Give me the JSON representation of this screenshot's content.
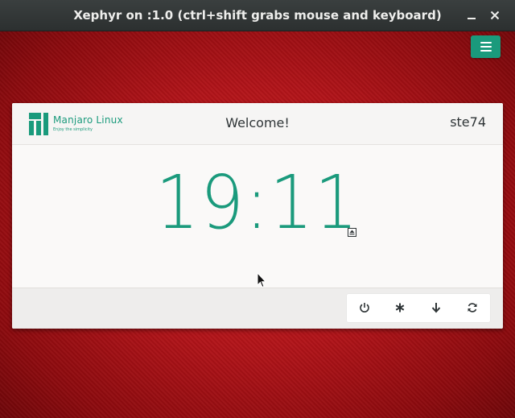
{
  "window": {
    "title": "Xephyr on :1.0 (ctrl+shift grabs mouse and keyboard)"
  },
  "greeter": {
    "brand_name": "Manjaro Linux",
    "brand_tagline": "Enjoy the simplicity",
    "welcome": "Welcome!",
    "username": "ste74",
    "clock": "19:11",
    "accent_color": "#1a9a7c",
    "background_color": "#b0141a"
  },
  "icons": {
    "menu": "hamburger-menu-icon",
    "session": "eject-icon",
    "actions": [
      "power-icon",
      "asterisk-icon",
      "suspend-arrow-icon",
      "restart-icon"
    ]
  }
}
